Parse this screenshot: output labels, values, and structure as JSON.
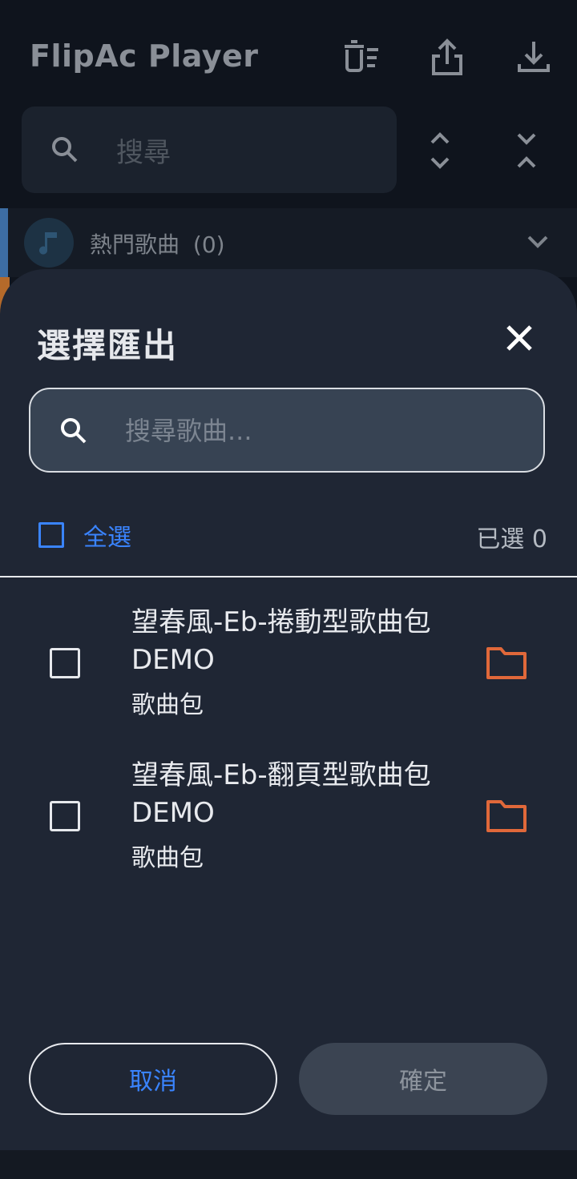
{
  "app": {
    "title": "FlipAc Player",
    "search_placeholder": "搜尋",
    "icons": [
      "delete-list-icon",
      "share-icon",
      "download-icon",
      "expand-icon",
      "collapse-icon"
    ],
    "category_row": {
      "label": "熱門歌曲",
      "count": "(0)",
      "icon": "music-note-icon"
    }
  },
  "dialog": {
    "title": "選擇匯出",
    "search_placeholder": "搜尋歌曲...",
    "search_value": "",
    "select_all_label": "全選",
    "selected_count": "已選 0",
    "items": [
      {
        "title": "望春風-Eb-捲動型歌曲包",
        "subtitle": "DEMO",
        "type": "歌曲包",
        "checked": false
      },
      {
        "title": "望春風-Eb-翻頁型歌曲包",
        "subtitle": "DEMO",
        "type": "歌曲包",
        "checked": false
      }
    ],
    "cancel_label": "取消",
    "confirm_label": "確定"
  },
  "colors": {
    "accent": "#3a84ff",
    "folder": "#e0683a",
    "sheet_bg": "#1f2634",
    "screen_bg": "#0f141d"
  }
}
